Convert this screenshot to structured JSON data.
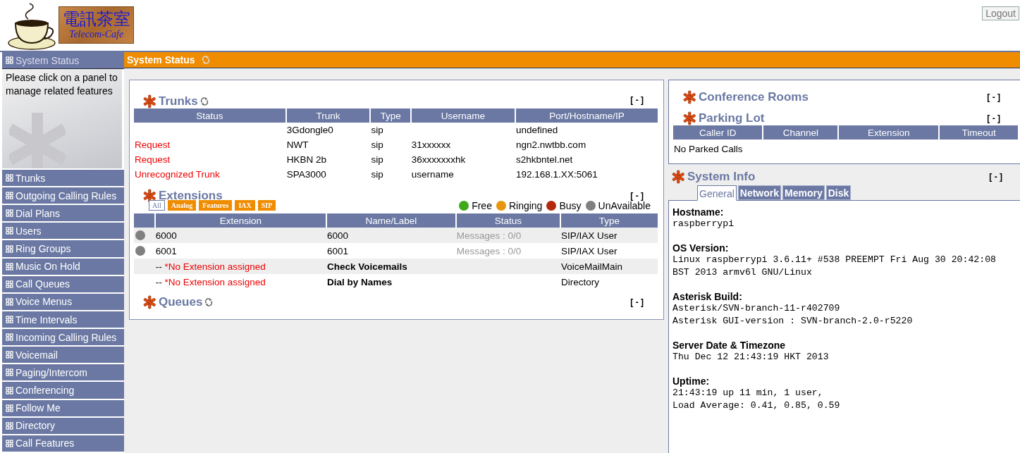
{
  "header": {
    "logo_cjk": "電訊茶室",
    "logo_latin": "Telecom-Cafe",
    "logout": "Logout"
  },
  "sidebar": {
    "hint": "Please click on a panel to manage related features",
    "items": [
      {
        "label": "System Status",
        "selected": true
      },
      {
        "label": "Trunks",
        "selected": false
      },
      {
        "label": "Outgoing Calling Rules",
        "selected": false
      },
      {
        "label": "Dial Plans",
        "selected": false
      },
      {
        "label": "Users",
        "selected": false
      },
      {
        "label": "Ring Groups",
        "selected": false
      },
      {
        "label": "Music On Hold",
        "selected": false
      },
      {
        "label": "Call Queues",
        "selected": false
      },
      {
        "label": "Voice Menus",
        "selected": false
      },
      {
        "label": "Time Intervals",
        "selected": false
      },
      {
        "label": "Incoming Calling Rules",
        "selected": false
      },
      {
        "label": "Voicemail",
        "selected": false
      },
      {
        "label": "Paging/Intercom",
        "selected": false
      },
      {
        "label": "Conferencing",
        "selected": false
      },
      {
        "label": "Follow Me",
        "selected": false
      },
      {
        "label": "Directory",
        "selected": false
      },
      {
        "label": "Call Features",
        "selected": false
      }
    ]
  },
  "page_title": "System Status",
  "trunks": {
    "title": "Trunks",
    "collapse": "[ - ]",
    "columns": [
      "Status",
      "Trunk",
      "Type",
      "Username",
      "Port/Hostname/IP"
    ],
    "rows": [
      {
        "cells": [
          "",
          "3Gdongle0",
          "sip",
          "",
          "undefined"
        ]
      },
      {
        "cells": [
          "Request",
          "NWT",
          "sip",
          "31xxxxxx",
          "ngn2.nwtbb.com"
        ]
      },
      {
        "cells": [
          "Request",
          "HKBN 2b",
          "sip",
          "36xxxxxxxhk",
          "s2hkbntel.net"
        ]
      },
      {
        "cells": [
          "Unrecognized Trunk",
          "SPA3000",
          "sip",
          "username",
          "192.168.1.XX:5061"
        ]
      }
    ]
  },
  "extensions": {
    "title": "Extensions",
    "collapse": "[ - ]",
    "filters": [
      {
        "label": "All",
        "selected": true
      },
      {
        "label": "Analog",
        "selected": false
      },
      {
        "label": "Features",
        "selected": false
      },
      {
        "label": "IAX",
        "selected": false
      },
      {
        "label": "SIP",
        "selected": false
      }
    ],
    "legend": [
      {
        "label": "Free",
        "color": "#3fa91a"
      },
      {
        "label": "Ringing",
        "color": "#e8960c"
      },
      {
        "label": "Busy",
        "color": "#b22a0a"
      },
      {
        "label": "UnAvailable",
        "color": "#808080"
      }
    ],
    "columns": [
      "Extension",
      "Name/Label",
      "Status",
      "Type"
    ],
    "rows": [
      {
        "kind": "user",
        "color": "#808080",
        "extension": "6000",
        "name": "6000",
        "status": "Messages : 0/0",
        "type": "SIP/IAX User"
      },
      {
        "kind": "user",
        "color": "#808080",
        "extension": "6001",
        "name": "6001",
        "status": "Messages : 0/0",
        "type": "SIP/IAX User"
      },
      {
        "kind": "feature",
        "prefix": "--",
        "extension": "*No Extension assigned",
        "name": "Check Voicemails",
        "type": "VoiceMailMain"
      },
      {
        "kind": "feature",
        "prefix": "--",
        "extension": "*No Extension assigned",
        "name": "Dial by Names",
        "type": "Directory"
      }
    ]
  },
  "queues": {
    "title": "Queues",
    "collapse": "[ - ]"
  },
  "conference": {
    "title": "Conference Rooms",
    "collapse": "[ - ]"
  },
  "parking": {
    "title": "Parking Lot",
    "collapse": "[ - ]",
    "columns": [
      "Caller ID",
      "Channel",
      "Extension",
      "Timeout"
    ],
    "empty": "No Parked Calls"
  },
  "system_info": {
    "title": "System Info",
    "collapse": "[ - ]",
    "tabs": [
      {
        "label": "General",
        "selected": true
      },
      {
        "label": "Network",
        "selected": false
      },
      {
        "label": "Memory",
        "selected": false
      },
      {
        "label": "Disk",
        "selected": false
      }
    ],
    "sections": [
      {
        "heading": "Hostname:",
        "lines": [
          "raspberrypi"
        ]
      },
      {
        "heading": "OS Version:",
        "lines": [
          "Linux raspberrypi 3.6.11+ #538 PREEMPT Fri Aug 30 20:42:08 BST 2013 armv6l GNU/Linux"
        ]
      },
      {
        "heading": "Asterisk Build:",
        "lines": [
          "Asterisk/SVN-branch-11-r402709",
          "Asterisk GUI-version : SVN-branch-2.0-r5220"
        ]
      },
      {
        "heading": "Server Date & Timezone",
        "lines": [
          "Thu Dec 12 21:43:19 HKT 2013"
        ]
      },
      {
        "heading": "Uptime:",
        "lines": [
          "21:43:19 up 11 min, 1 user,",
          "Load Average: 0.41, 0.85, 0.59"
        ]
      }
    ]
  }
}
